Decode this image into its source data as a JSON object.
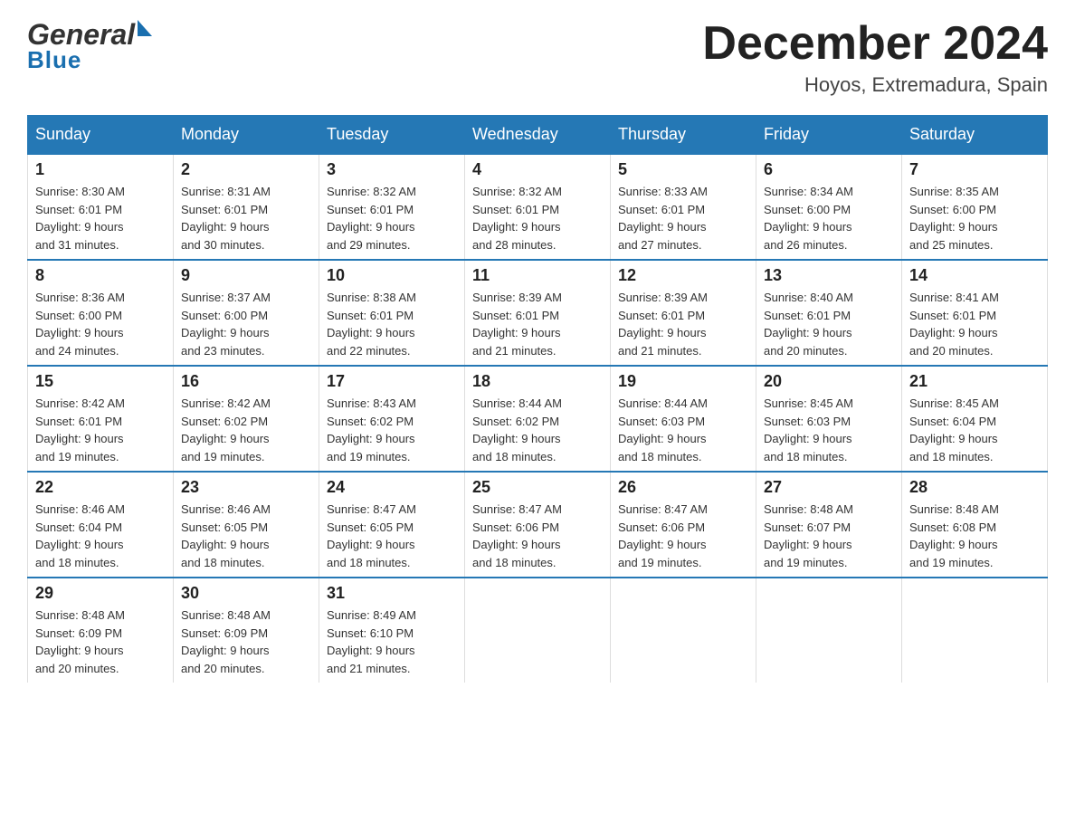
{
  "logo": {
    "general": "General",
    "blue": "Blue"
  },
  "title": {
    "month_year": "December 2024",
    "location": "Hoyos, Extremadura, Spain"
  },
  "headers": [
    "Sunday",
    "Monday",
    "Tuesday",
    "Wednesday",
    "Thursday",
    "Friday",
    "Saturday"
  ],
  "weeks": [
    [
      {
        "day": "1",
        "info": "Sunrise: 8:30 AM\nSunset: 6:01 PM\nDaylight: 9 hours\nand 31 minutes."
      },
      {
        "day": "2",
        "info": "Sunrise: 8:31 AM\nSunset: 6:01 PM\nDaylight: 9 hours\nand 30 minutes."
      },
      {
        "day": "3",
        "info": "Sunrise: 8:32 AM\nSunset: 6:01 PM\nDaylight: 9 hours\nand 29 minutes."
      },
      {
        "day": "4",
        "info": "Sunrise: 8:32 AM\nSunset: 6:01 PM\nDaylight: 9 hours\nand 28 minutes."
      },
      {
        "day": "5",
        "info": "Sunrise: 8:33 AM\nSunset: 6:01 PM\nDaylight: 9 hours\nand 27 minutes."
      },
      {
        "day": "6",
        "info": "Sunrise: 8:34 AM\nSunset: 6:00 PM\nDaylight: 9 hours\nand 26 minutes."
      },
      {
        "day": "7",
        "info": "Sunrise: 8:35 AM\nSunset: 6:00 PM\nDaylight: 9 hours\nand 25 minutes."
      }
    ],
    [
      {
        "day": "8",
        "info": "Sunrise: 8:36 AM\nSunset: 6:00 PM\nDaylight: 9 hours\nand 24 minutes."
      },
      {
        "day": "9",
        "info": "Sunrise: 8:37 AM\nSunset: 6:00 PM\nDaylight: 9 hours\nand 23 minutes."
      },
      {
        "day": "10",
        "info": "Sunrise: 8:38 AM\nSunset: 6:01 PM\nDaylight: 9 hours\nand 22 minutes."
      },
      {
        "day": "11",
        "info": "Sunrise: 8:39 AM\nSunset: 6:01 PM\nDaylight: 9 hours\nand 21 minutes."
      },
      {
        "day": "12",
        "info": "Sunrise: 8:39 AM\nSunset: 6:01 PM\nDaylight: 9 hours\nand 21 minutes."
      },
      {
        "day": "13",
        "info": "Sunrise: 8:40 AM\nSunset: 6:01 PM\nDaylight: 9 hours\nand 20 minutes."
      },
      {
        "day": "14",
        "info": "Sunrise: 8:41 AM\nSunset: 6:01 PM\nDaylight: 9 hours\nand 20 minutes."
      }
    ],
    [
      {
        "day": "15",
        "info": "Sunrise: 8:42 AM\nSunset: 6:01 PM\nDaylight: 9 hours\nand 19 minutes."
      },
      {
        "day": "16",
        "info": "Sunrise: 8:42 AM\nSunset: 6:02 PM\nDaylight: 9 hours\nand 19 minutes."
      },
      {
        "day": "17",
        "info": "Sunrise: 8:43 AM\nSunset: 6:02 PM\nDaylight: 9 hours\nand 19 minutes."
      },
      {
        "day": "18",
        "info": "Sunrise: 8:44 AM\nSunset: 6:02 PM\nDaylight: 9 hours\nand 18 minutes."
      },
      {
        "day": "19",
        "info": "Sunrise: 8:44 AM\nSunset: 6:03 PM\nDaylight: 9 hours\nand 18 minutes."
      },
      {
        "day": "20",
        "info": "Sunrise: 8:45 AM\nSunset: 6:03 PM\nDaylight: 9 hours\nand 18 minutes."
      },
      {
        "day": "21",
        "info": "Sunrise: 8:45 AM\nSunset: 6:04 PM\nDaylight: 9 hours\nand 18 minutes."
      }
    ],
    [
      {
        "day": "22",
        "info": "Sunrise: 8:46 AM\nSunset: 6:04 PM\nDaylight: 9 hours\nand 18 minutes."
      },
      {
        "day": "23",
        "info": "Sunrise: 8:46 AM\nSunset: 6:05 PM\nDaylight: 9 hours\nand 18 minutes."
      },
      {
        "day": "24",
        "info": "Sunrise: 8:47 AM\nSunset: 6:05 PM\nDaylight: 9 hours\nand 18 minutes."
      },
      {
        "day": "25",
        "info": "Sunrise: 8:47 AM\nSunset: 6:06 PM\nDaylight: 9 hours\nand 18 minutes."
      },
      {
        "day": "26",
        "info": "Sunrise: 8:47 AM\nSunset: 6:06 PM\nDaylight: 9 hours\nand 19 minutes."
      },
      {
        "day": "27",
        "info": "Sunrise: 8:48 AM\nSunset: 6:07 PM\nDaylight: 9 hours\nand 19 minutes."
      },
      {
        "day": "28",
        "info": "Sunrise: 8:48 AM\nSunset: 6:08 PM\nDaylight: 9 hours\nand 19 minutes."
      }
    ],
    [
      {
        "day": "29",
        "info": "Sunrise: 8:48 AM\nSunset: 6:09 PM\nDaylight: 9 hours\nand 20 minutes."
      },
      {
        "day": "30",
        "info": "Sunrise: 8:48 AM\nSunset: 6:09 PM\nDaylight: 9 hours\nand 20 minutes."
      },
      {
        "day": "31",
        "info": "Sunrise: 8:49 AM\nSunset: 6:10 PM\nDaylight: 9 hours\nand 21 minutes."
      },
      {
        "day": "",
        "info": ""
      },
      {
        "day": "",
        "info": ""
      },
      {
        "day": "",
        "info": ""
      },
      {
        "day": "",
        "info": ""
      }
    ]
  ]
}
